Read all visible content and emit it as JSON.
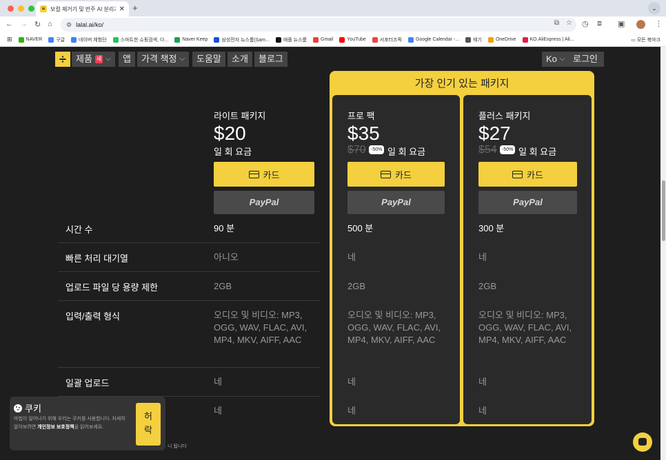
{
  "browser": {
    "tab_title": "보컬 제거기 및 반주 AI 분리기 | L/",
    "url": "lalal.ai/ko/",
    "bookmarks": [
      {
        "label": "NAVER",
        "color": "#2db400"
      },
      {
        "label": "구글",
        "color": "#4285f4"
      },
      {
        "label": "네이버 체험단",
        "color": "#3b82f6"
      },
      {
        "label": "스마트한 쇼핑검색, 다...",
        "color": "#22c55e"
      },
      {
        "label": "Naver Keep",
        "color": "#16a34a"
      },
      {
        "label": "삼성전자 뉴스룸(Sam...",
        "color": "#1d4ed8"
      },
      {
        "label": "애플 뉴스룸",
        "color": "#111111"
      },
      {
        "label": "Gmail",
        "color": "#ea4335"
      },
      {
        "label": "YouTube",
        "color": "#ff0000"
      },
      {
        "label": "서포터즈픽",
        "color": "#ef4444"
      },
      {
        "label": "Google Calendar -...",
        "color": "#4285f4"
      },
      {
        "label": "웨기",
        "color": "#555555"
      },
      {
        "label": "OneDrive",
        "color": "#f59e0b"
      },
      {
        "label": "KO.AliExpress | Ali...",
        "color": "#e11d48"
      }
    ],
    "all_bookmarks": "모든 북마크"
  },
  "nav": {
    "products": "제품",
    "new_badge": "새",
    "app": "앱",
    "pricing": "가격 책정",
    "help": "도움말",
    "about": "소개",
    "blog": "블로그",
    "lang": "Ko",
    "login": "로그인"
  },
  "popular_label": "가장 인기 있는 패키지",
  "plans": [
    {
      "name": "라이트 패키지",
      "price": "$20",
      "original": "",
      "discount": "",
      "billing": "일 회 요금",
      "card": "카드",
      "paypal": "PayPal"
    },
    {
      "name": "프로 팩",
      "price": "$35",
      "original": "$70",
      "discount": "-50%",
      "billing": "일 회 요금",
      "card": "카드",
      "paypal": "PayPal"
    },
    {
      "name": "플러스 패키지",
      "price": "$27",
      "original": "$54",
      "discount": "-50%",
      "billing": "일 회 요금",
      "card": "카드",
      "paypal": "PayPal"
    }
  ],
  "rows": [
    {
      "label": "시간 수",
      "values": [
        "90 분",
        "500 분",
        "300 분"
      ]
    },
    {
      "label": "빠른 처리 대기열",
      "values": [
        "아니오",
        "네",
        "네"
      ]
    },
    {
      "label": "업로드 파일 당 용량 제한",
      "values": [
        "2GB",
        "2GB",
        "2GB"
      ]
    },
    {
      "label": "입력/출력 형식",
      "values": [
        "오디오 및 비디오: MP3, OGG, WAV, FLAC, AVI, MP4, MKV, AIFF, AAC",
        "오디오 및 비디오: MP3, OGG, WAV, FLAC, AVI, MP4, MKV, AIFF, AAC",
        "오디오 및 비디오: MP3, OGG, WAV, FLAC, AVI, MP4, MKV, AIFF, AAC"
      ]
    },
    {
      "label": "일괄 업로드",
      "values": [
        "네",
        "네",
        "네"
      ]
    },
    {
      "label": "",
      "values": [
        "네",
        "네",
        "네"
      ]
    }
  ],
  "cookie": {
    "title": "쿠키",
    "text_before": "마법이 일어나기 위해 우리는 쿠키를 사용합니다. 자세히 알아보려면",
    "link": "개인정보 보호정책",
    "text_after": "을 읽어보세요.",
    "accept": "허락",
    "footer_fragment": "니 됩니다"
  },
  "colors": {
    "accent": "#f4d03f",
    "bg": "#1e1e1e",
    "card": "#2a2a2a"
  }
}
